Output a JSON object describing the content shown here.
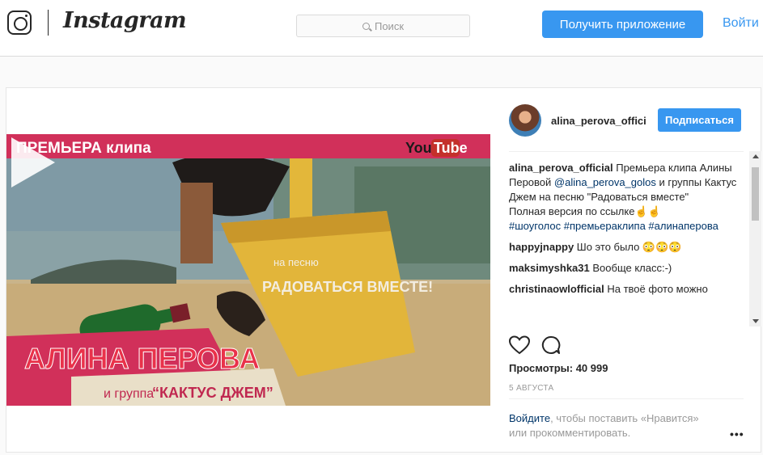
{
  "header": {
    "logo_text": "Instagram",
    "search_placeholder": "Поиск",
    "get_app_label": "Получить приложение",
    "login_label": "Войти"
  },
  "media": {
    "banner_top": "ПРЕМЬЕРА клипа",
    "youtube_you": "You",
    "youtube_tube": "Tube",
    "song_prefix": "на песню",
    "song_title": "РАДОВАТЬСЯ ВМЕСТЕ!",
    "artist": "АЛИНА ПЕРОВА",
    "band_prefix": "и группа",
    "band_name": "“КАКТУС ДЖЕМ”"
  },
  "post": {
    "author": "alina_perova_official",
    "follow_label": "Подписаться",
    "caption": {
      "user": "alina_perova_official",
      "text_1": " Премьера клипа Алины Перовой ",
      "mention": "@alina_perova_golos",
      "text_2": " и группы Кактус Джем на песню \"Радоваться вместе\"",
      "line_full": "Полная версия по ссылке☝☝",
      "tags": "#шоуголос #премьераклипа #алинаперова"
    },
    "comments": [
      {
        "user": "happyjnappy",
        "text": " Шо это было 😳😳😳"
      },
      {
        "user": "maksimyshka31",
        "text": " Вообще класс:-)"
      },
      {
        "user": "christinaowlofficial",
        "text": " На твоё фото можно"
      }
    ],
    "views_label": "Просмотры: 40 999",
    "date": "5 АВГУСТА",
    "login_link": "Войдите",
    "login_text": ", чтобы поставить «Нравится» или прокомментировать.",
    "more_label": "•••"
  },
  "colors": {
    "accent": "#3897f0",
    "banner_pink": "#d1305a",
    "link": "#003569"
  },
  "icons": {
    "heart": "heart-icon",
    "comment": "comment-bubble-icon",
    "play": "play-icon",
    "search": "search-icon",
    "more": "more-icon"
  }
}
